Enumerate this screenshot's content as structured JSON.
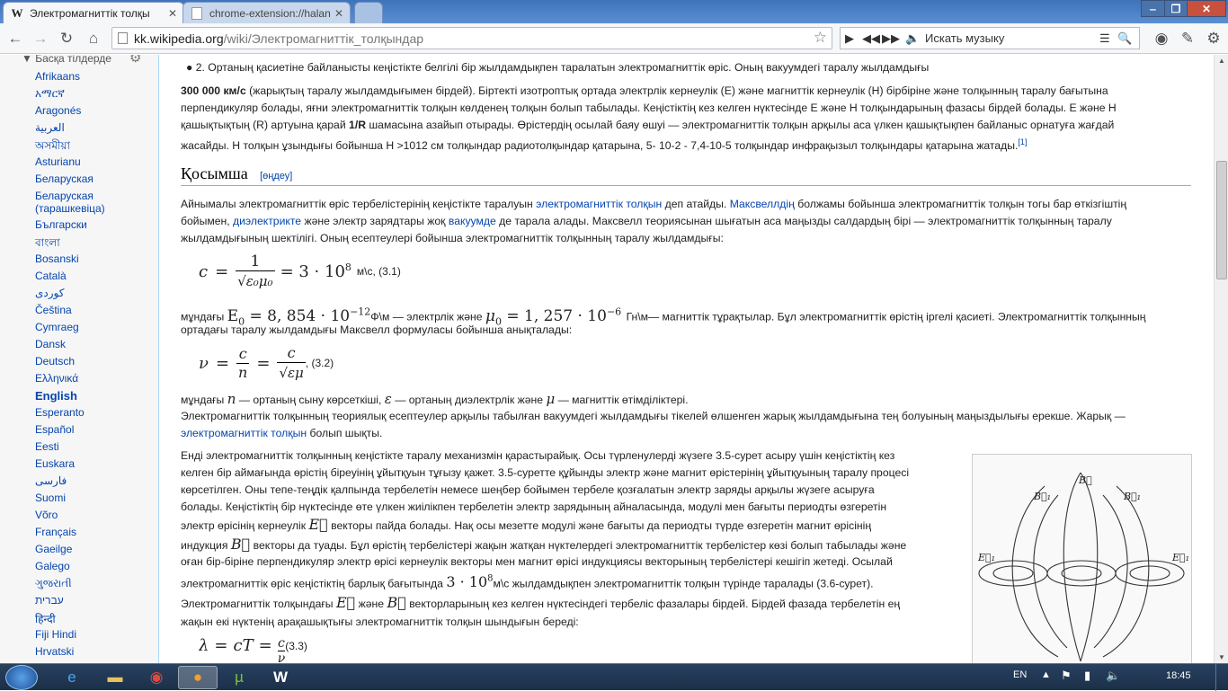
{
  "browser": {
    "tabs": [
      {
        "title": "Электромагниттік толқы",
        "favicon": "W"
      },
      {
        "title": "chrome-extension://halan",
        "favicon": "page-icon"
      }
    ],
    "url_host": "kk.wikipedia.org",
    "url_path": "/wiki/Электромагниттік_толқындар",
    "music_search_placeholder": "Искать музыку"
  },
  "sidebar": {
    "heading": "Басқа тілдерде",
    "languages": [
      "Afrikaans",
      "አማርኛ",
      "Aragonés",
      "العربية",
      "অসমীয়া",
      "Asturianu",
      "Беларуская",
      "Беларуская (тарашкевіца)",
      "Български",
      "বাংলা",
      "Bosanski",
      "Català",
      "کوردی",
      "Čeština",
      "Cymraeg",
      "Dansk",
      "Deutsch",
      "Ελληνικά",
      "English",
      "Esperanto",
      "Español",
      "Eesti",
      "Euskara",
      "فارسی",
      "Suomi",
      "Võro",
      "Français",
      "Gaeilge",
      "Galego",
      "ગુજરાતી",
      "עברית",
      "हिन्दी",
      "Fiji Hindi",
      "Hrvatski"
    ],
    "current": "English"
  },
  "article": {
    "bullet": "2. Ортаның қасиетіне байланысты кеңістікте белгілі бір жылдамдықпен таралатын электромагниттік өріс. Оның вакуумдегі таралу жылдамдығы",
    "speed_bold": "300 000 км/с",
    "p1_l1_rest": " (жарықтың таралу жылдамдығымен бірдей). Біртекті изотроптық ортада электрлік кернеулік (Е) және магниттік кернеулік (Н) бірбіріне және толқынның таралу бағытына",
    "p1_l2": "перпендикуляр болады, яғни электромагниттік толқын көлденең толқын болып табылады. Кеңістіктің кез келген нүктесінде Е және Н толқындарының фазасы бірдей болады. Е және Н",
    "p1_l3_a": "қашықтықтың (R) артуына қарай ",
    "p1_l3_b": "1/R",
    "p1_l3_c": " шамасына азайып отырады. Өрістердің осылай баяу өшуі — электромагниттік толқын арқылы аса үлкен қашықтықпен байланыс орнатуға жағдай",
    "p1_l4": "жасайды. Н толқын ұзындығы бойынша Н >1012 см толқындар радиотолқындар қатарына, 5- 10-2 - 7,4-10-5 толқындар инфрақызыл толқындары қатарына жатады.",
    "ref1": "[1]",
    "section_title": "Қосымша",
    "section_edit": "[өңдеу]",
    "p2_l1_a": "Айнымалы электромагниттік өріс тербелістерінің кеңістікте таралуын ",
    "link_em_wave": "электромагниттік толқын",
    "p2_l1_b": " деп атайды. ",
    "link_maxwell": "Максвеллдің",
    "p2_l1_c": " болжамы бойынша электромагниттік толқын тогы бар өткізгіштің",
    "p2_l2_a": "бойымен, ",
    "link_dielectric": "диэлектрикте",
    "p2_l2_b": " және электр зарядтары жоқ ",
    "link_vacuum": "вакуумде",
    "p2_l2_c": " де тарала алады. Максвелл теориясынан шығатын аса маңызды салдардың бірі — электромагниттік толқынның таралу",
    "p2_l3": "жылдамдығының шектілігі. Оның есептеулері бойынша электромагниттік толқынның таралу жылдамдығы:",
    "eq31_units": "м\\с, (3.1)",
    "p3_a": "мұндағы ",
    "p3_b": "Ф\\м — электрлік және ",
    "p3_c": "Гн\\м— магниттік тұрақтылар. Бұл электромагниттік өрістің іргелі қасиеті. Электромагниттік толқынның",
    "p3_l2": "ортадағы таралу жылдамдығы Максвелл формуласы бойынша анықталады:",
    "eq32_label": ", (3.2)",
    "p4_a": "мұндағы ",
    "p4_b": " — ортаның сыну көрсеткіші, ",
    "p4_c": " — ортаның диэлектрлік және ",
    "p4_d": " — магниттік өтімділіктері.",
    "p5_l1": "Электромагниттік толқынның теориялық есептеулер арқылы табылған вакуумдегі жылдамдығы тікелей өлшенген жарық жылдамдығына тең болуының маңыздылығы ерекше. Жарық —",
    "p5_link": "электромагниттік толқын",
    "p5_l2_b": " болып шықты.",
    "p6_l1": "Енді электромагниттік толқынның кеңістікте таралу механизмін қарастырайық. Осы түрленулерді жүзеге 3.5-сурет асыру үшін кеңістіктің кез",
    "p6_l2": "келген бір аймағында өрістің біреуінің ұйытқуын тұғызу қажет. 3.5-суретте құйынды электр және магнит өрістерінің ұйытқуының таралу процесі",
    "p6_l3": "көрсетілген. Оны тепе-теңдік қалпында тербелетін немесе шеңбер бойымен тербеле қозғалатын электр заряды арқылы жүзеге асыруға",
    "p6_l4": "болады. Кеңістіктің бір нүктесінде өте үлкен жиілікпен тербелетін электр зарядының айналасында, модулі мен бағыты периодты өзгеретін",
    "p6_l5_a": "электр өрісінің кернеулік ",
    "p6_l5_b": " векторы пайда болады. Нақ осы мезетте модулі және бағыты да периодты түрде өзгеретін магнит өрісінің",
    "p6_l6_a": "индукция ",
    "p6_l6_b": " векторы да туады. Бұл өрістің тербелістері жақын жатқан нүктелердегі электромагниттік тербелістер көзі болып табылады және",
    "p6_l7": "оған бір-біріне перпендикуляр электр өрісі кернеулік векторы мен магнит өрісі индукциясы векторының тербелістері кешігіп жетеді. Осылай",
    "p6_l8_a": "электромагниттік өріс кеңістіктің барлық бағытында ",
    "p6_l8_b": "м\\с жылдамдықпен электромагниттік толқын түрінде таралады (3.6-сурет).",
    "p7_a": "Электромагниттік толқындағы ",
    "p7_b": " және ",
    "p7_c": " векторларының кез келген нүктесіндегі тербеліс фазалары бірдей. Бірдей фазада тербелетін ең",
    "p7_l2": "жақын екі нүктенің арақашықтығы электромагниттік толқын шындығын береді:",
    "eq33_label": " (3.3)"
  },
  "taskbar": {
    "lang": "EN",
    "time": "18:45"
  }
}
